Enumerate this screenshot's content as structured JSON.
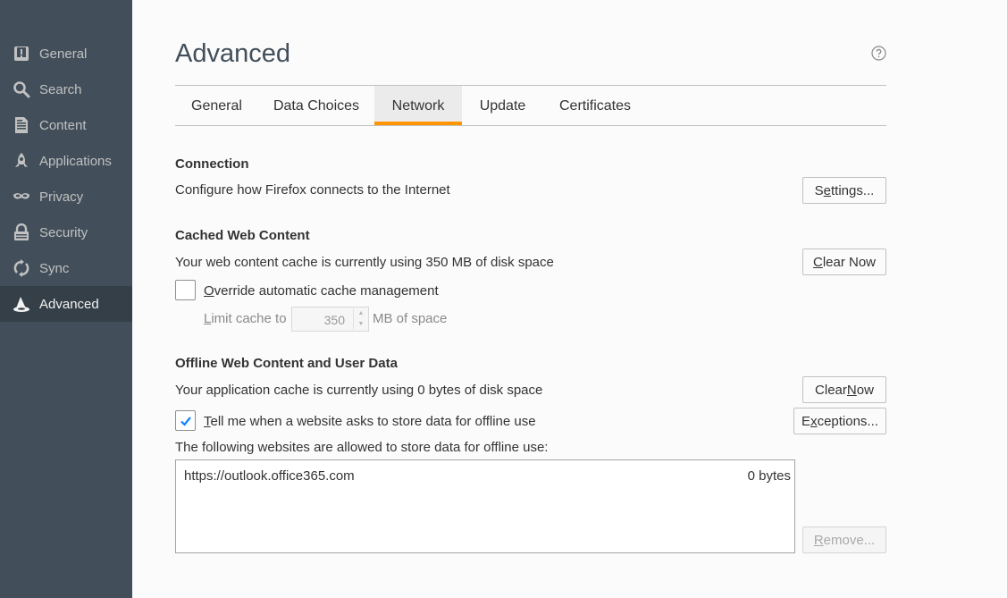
{
  "sidebar": {
    "items": [
      {
        "label": "General",
        "icon": "general-icon"
      },
      {
        "label": "Search",
        "icon": "search-icon"
      },
      {
        "label": "Content",
        "icon": "content-icon"
      },
      {
        "label": "Applications",
        "icon": "applications-icon"
      },
      {
        "label": "Privacy",
        "icon": "privacy-mask-icon"
      },
      {
        "label": "Security",
        "icon": "lock-icon"
      },
      {
        "label": "Sync",
        "icon": "sync-icon"
      },
      {
        "label": "Advanced",
        "icon": "advanced-wizard-hat-icon",
        "selected": true
      }
    ]
  },
  "page": {
    "title": "Advanced",
    "help_icon": "question-mark-icon"
  },
  "tabs": [
    {
      "label": "General"
    },
    {
      "label": "Data Choices"
    },
    {
      "label": "Network",
      "selected": true
    },
    {
      "label": "Update"
    },
    {
      "label": "Certificates"
    }
  ],
  "connection": {
    "heading": "Connection",
    "description": "Configure how Firefox connects to the Internet",
    "settings_button": {
      "pre": "S",
      "accel": "e",
      "post": "ttings..."
    }
  },
  "cache": {
    "heading": "Cached Web Content",
    "description": "Your web content cache is currently using 350 MB of disk space",
    "clear_button": {
      "pre": "",
      "accel": "C",
      "post": "lear Now"
    },
    "override_checkbox": {
      "pre": "",
      "accel": "O",
      "post": "verride automatic cache management",
      "checked": false
    },
    "limit_label": {
      "pre": "",
      "accel": "L",
      "post": "imit cache to"
    },
    "limit_value": "350",
    "limit_suffix": "MB of space"
  },
  "offline": {
    "heading": "Offline Web Content and User Data",
    "description": "Your application cache is currently using 0 bytes of disk space",
    "clear_button": {
      "pre": "Clear ",
      "accel": "N",
      "post": "ow"
    },
    "tell_checkbox": {
      "pre": "",
      "accel": "T",
      "post": "ell me when a website asks to store data for offline use",
      "checked": true
    },
    "exceptions_button": {
      "pre": "E",
      "accel": "x",
      "post": "ceptions..."
    },
    "list_label": "The following websites are allowed to store data for offline use:",
    "sites": [
      {
        "url": "https://outlook.office365.com",
        "size": "0 bytes"
      }
    ],
    "remove_button": {
      "pre": "",
      "accel": "R",
      "post": "emove..."
    }
  },
  "colors": {
    "sidebar_bg": "#424f5a",
    "sidebar_selected_bg": "#343f48",
    "accent": "#ff9500",
    "checkmark": "#0a84ff"
  }
}
